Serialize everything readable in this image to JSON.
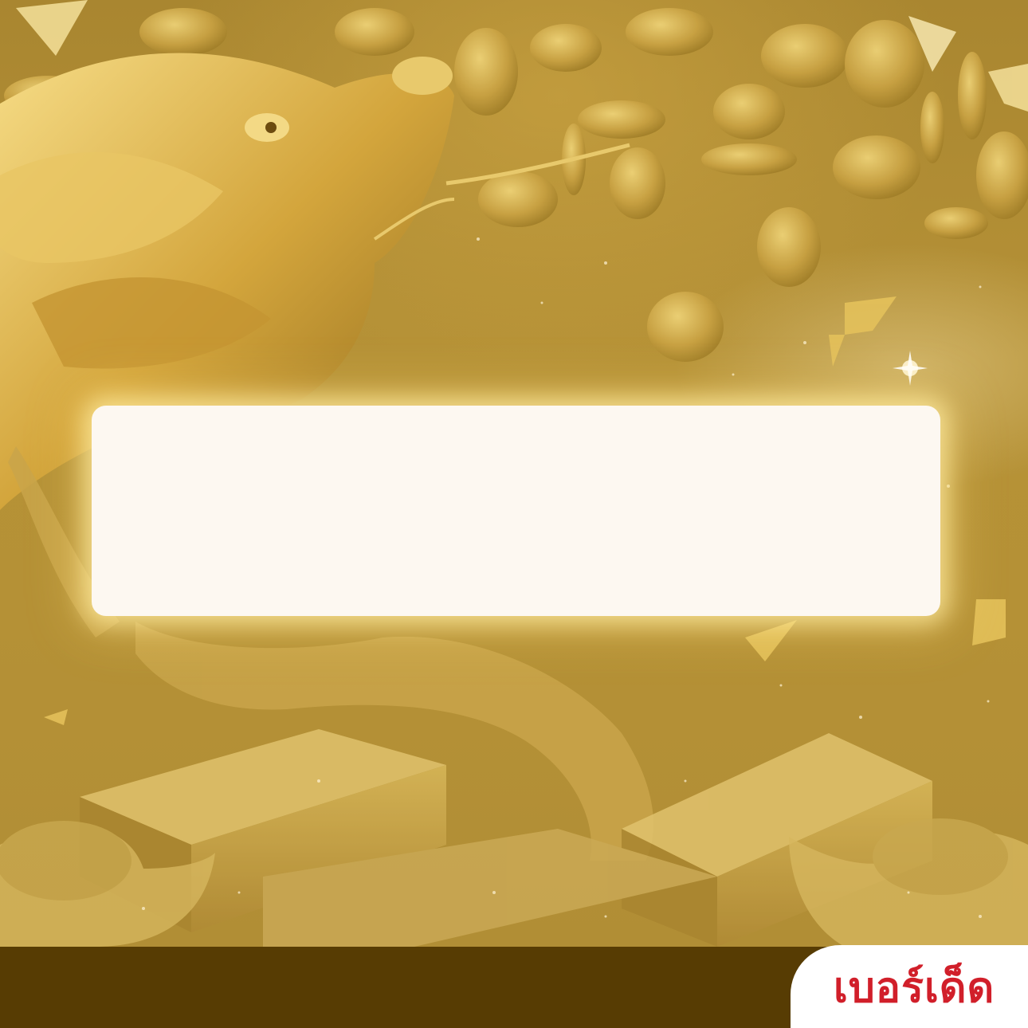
{
  "brand": {
    "logo_text": "เบอร์เด็ด",
    "logo_color": "#d11f2a"
  },
  "colors": {
    "background_gold": "#b59136",
    "card_fill": "#fdf8f1",
    "footer_brown": "#573c03"
  }
}
